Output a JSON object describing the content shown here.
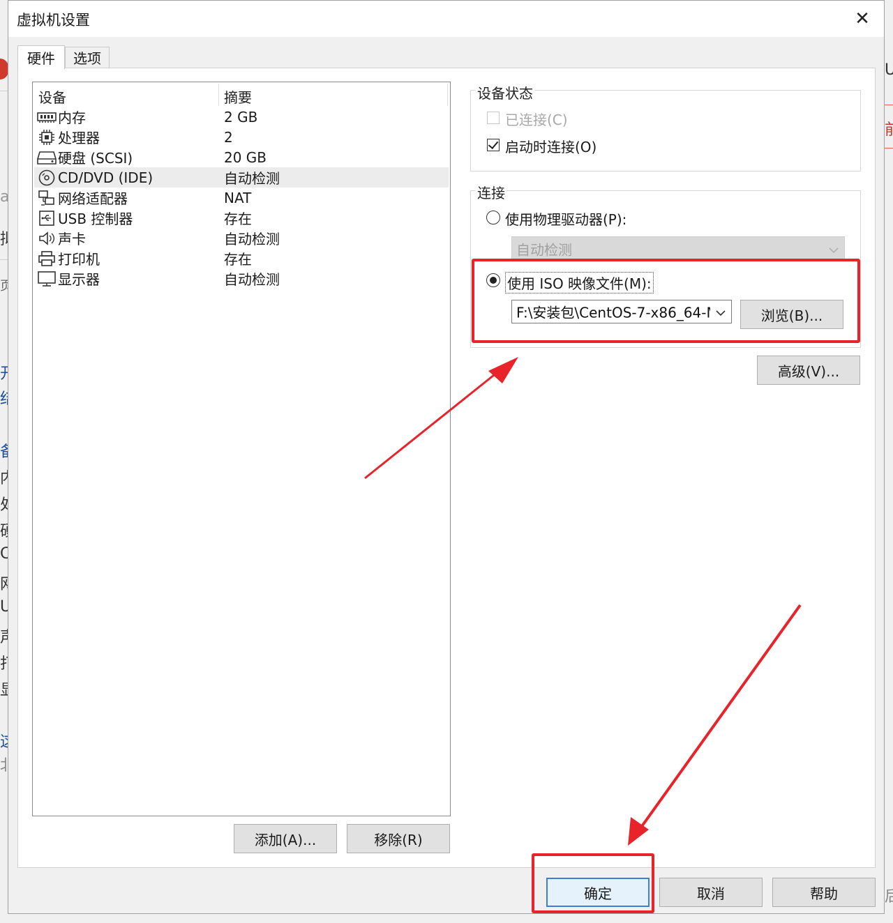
{
  "window": {
    "title": "虚拟机设置",
    "close_glyph": "✕"
  },
  "tabs": [
    {
      "label": "硬件",
      "active": true
    },
    {
      "label": "选项",
      "active": false
    }
  ],
  "device_list": {
    "col_device": "设备",
    "col_summary": "摘要",
    "items": [
      {
        "icon": "memory-icon",
        "name": "内存",
        "summary": "2 GB"
      },
      {
        "icon": "processor-icon",
        "name": "处理器",
        "summary": "2"
      },
      {
        "icon": "hard-disk-icon",
        "name": "硬盘 (SCSI)",
        "summary": "20 GB"
      },
      {
        "icon": "cd-dvd-icon",
        "name": "CD/DVD (IDE)",
        "summary": "自动检测",
        "selected": true
      },
      {
        "icon": "network-adapter-icon",
        "name": "网络适配器",
        "summary": "NAT"
      },
      {
        "icon": "usb-icon",
        "name": "USB 控制器",
        "summary": "存在"
      },
      {
        "icon": "speaker-icon",
        "name": "声卡",
        "summary": "自动检测"
      },
      {
        "icon": "printer-icon",
        "name": "打印机",
        "summary": "存在"
      },
      {
        "icon": "display-icon",
        "name": "显示器",
        "summary": "自动检测"
      }
    ],
    "add_button": "添加(A)...",
    "remove_button": "移除(R)"
  },
  "device_status": {
    "title": "设备状态",
    "connected_label": "已连接(C)",
    "connected_checked": false,
    "connected_enabled": false,
    "connect_on_start_label": "启动时连接(O)",
    "connect_on_start_checked": true
  },
  "connection": {
    "title": "连接",
    "physical_drive_label": "使用物理驱动器(P):",
    "physical_drive_value": "自动检测",
    "iso_label": "使用 ISO 映像文件(M):",
    "iso_selected": true,
    "iso_path": "F:\\安装包\\CentOS-7-x86_64-M",
    "browse_button": "浏览(B)..."
  },
  "advanced_button": "高级(V)...",
  "footer": {
    "ok_button": "确定",
    "cancel_button": "取消",
    "help_button": "帮助"
  },
  "background_fragments": [
    "Ut",
    "前",
    "at",
    "拟",
    "页",
    "开",
    "结",
    "备",
    "内",
    "处",
    "硬",
    "C",
    "网",
    "U",
    "声",
    "打",
    "显",
    "这",
    "北",
    "后"
  ],
  "colors": {
    "annotation_red": "#e8232a",
    "selected_row": "#ececec",
    "default_button_border": "#3c7fd0"
  }
}
